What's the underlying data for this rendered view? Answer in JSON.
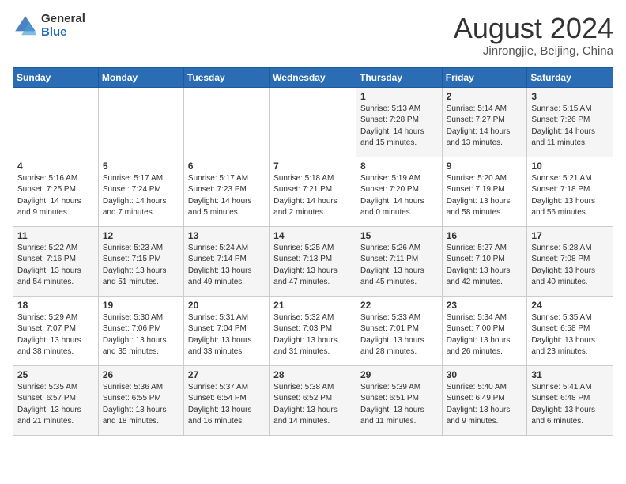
{
  "header": {
    "logo_general": "General",
    "logo_blue": "Blue",
    "title": "August 2024",
    "subtitle": "Jinrongjie, Beijing, China"
  },
  "weekdays": [
    "Sunday",
    "Monday",
    "Tuesday",
    "Wednesday",
    "Thursday",
    "Friday",
    "Saturday"
  ],
  "weeks": [
    [
      {
        "day": "",
        "sunrise": "",
        "sunset": "",
        "daylight": ""
      },
      {
        "day": "",
        "sunrise": "",
        "sunset": "",
        "daylight": ""
      },
      {
        "day": "",
        "sunrise": "",
        "sunset": "",
        "daylight": ""
      },
      {
        "day": "",
        "sunrise": "",
        "sunset": "",
        "daylight": ""
      },
      {
        "day": "1",
        "sunrise": "Sunrise: 5:13 AM",
        "sunset": "Sunset: 7:28 PM",
        "daylight": "Daylight: 14 hours and 15 minutes."
      },
      {
        "day": "2",
        "sunrise": "Sunrise: 5:14 AM",
        "sunset": "Sunset: 7:27 PM",
        "daylight": "Daylight: 14 hours and 13 minutes."
      },
      {
        "day": "3",
        "sunrise": "Sunrise: 5:15 AM",
        "sunset": "Sunset: 7:26 PM",
        "daylight": "Daylight: 14 hours and 11 minutes."
      }
    ],
    [
      {
        "day": "4",
        "sunrise": "Sunrise: 5:16 AM",
        "sunset": "Sunset: 7:25 PM",
        "daylight": "Daylight: 14 hours and 9 minutes."
      },
      {
        "day": "5",
        "sunrise": "Sunrise: 5:17 AM",
        "sunset": "Sunset: 7:24 PM",
        "daylight": "Daylight: 14 hours and 7 minutes."
      },
      {
        "day": "6",
        "sunrise": "Sunrise: 5:17 AM",
        "sunset": "Sunset: 7:23 PM",
        "daylight": "Daylight: 14 hours and 5 minutes."
      },
      {
        "day": "7",
        "sunrise": "Sunrise: 5:18 AM",
        "sunset": "Sunset: 7:21 PM",
        "daylight": "Daylight: 14 hours and 2 minutes."
      },
      {
        "day": "8",
        "sunrise": "Sunrise: 5:19 AM",
        "sunset": "Sunset: 7:20 PM",
        "daylight": "Daylight: 14 hours and 0 minutes."
      },
      {
        "day": "9",
        "sunrise": "Sunrise: 5:20 AM",
        "sunset": "Sunset: 7:19 PM",
        "daylight": "Daylight: 13 hours and 58 minutes."
      },
      {
        "day": "10",
        "sunrise": "Sunrise: 5:21 AM",
        "sunset": "Sunset: 7:18 PM",
        "daylight": "Daylight: 13 hours and 56 minutes."
      }
    ],
    [
      {
        "day": "11",
        "sunrise": "Sunrise: 5:22 AM",
        "sunset": "Sunset: 7:16 PM",
        "daylight": "Daylight: 13 hours and 54 minutes."
      },
      {
        "day": "12",
        "sunrise": "Sunrise: 5:23 AM",
        "sunset": "Sunset: 7:15 PM",
        "daylight": "Daylight: 13 hours and 51 minutes."
      },
      {
        "day": "13",
        "sunrise": "Sunrise: 5:24 AM",
        "sunset": "Sunset: 7:14 PM",
        "daylight": "Daylight: 13 hours and 49 minutes."
      },
      {
        "day": "14",
        "sunrise": "Sunrise: 5:25 AM",
        "sunset": "Sunset: 7:13 PM",
        "daylight": "Daylight: 13 hours and 47 minutes."
      },
      {
        "day": "15",
        "sunrise": "Sunrise: 5:26 AM",
        "sunset": "Sunset: 7:11 PM",
        "daylight": "Daylight: 13 hours and 45 minutes."
      },
      {
        "day": "16",
        "sunrise": "Sunrise: 5:27 AM",
        "sunset": "Sunset: 7:10 PM",
        "daylight": "Daylight: 13 hours and 42 minutes."
      },
      {
        "day": "17",
        "sunrise": "Sunrise: 5:28 AM",
        "sunset": "Sunset: 7:08 PM",
        "daylight": "Daylight: 13 hours and 40 minutes."
      }
    ],
    [
      {
        "day": "18",
        "sunrise": "Sunrise: 5:29 AM",
        "sunset": "Sunset: 7:07 PM",
        "daylight": "Daylight: 13 hours and 38 minutes."
      },
      {
        "day": "19",
        "sunrise": "Sunrise: 5:30 AM",
        "sunset": "Sunset: 7:06 PM",
        "daylight": "Daylight: 13 hours and 35 minutes."
      },
      {
        "day": "20",
        "sunrise": "Sunrise: 5:31 AM",
        "sunset": "Sunset: 7:04 PM",
        "daylight": "Daylight: 13 hours and 33 minutes."
      },
      {
        "day": "21",
        "sunrise": "Sunrise: 5:32 AM",
        "sunset": "Sunset: 7:03 PM",
        "daylight": "Daylight: 13 hours and 31 minutes."
      },
      {
        "day": "22",
        "sunrise": "Sunrise: 5:33 AM",
        "sunset": "Sunset: 7:01 PM",
        "daylight": "Daylight: 13 hours and 28 minutes."
      },
      {
        "day": "23",
        "sunrise": "Sunrise: 5:34 AM",
        "sunset": "Sunset: 7:00 PM",
        "daylight": "Daylight: 13 hours and 26 minutes."
      },
      {
        "day": "24",
        "sunrise": "Sunrise: 5:35 AM",
        "sunset": "Sunset: 6:58 PM",
        "daylight": "Daylight: 13 hours and 23 minutes."
      }
    ],
    [
      {
        "day": "25",
        "sunrise": "Sunrise: 5:35 AM",
        "sunset": "Sunset: 6:57 PM",
        "daylight": "Daylight: 13 hours and 21 minutes."
      },
      {
        "day": "26",
        "sunrise": "Sunrise: 5:36 AM",
        "sunset": "Sunset: 6:55 PM",
        "daylight": "Daylight: 13 hours and 18 minutes."
      },
      {
        "day": "27",
        "sunrise": "Sunrise: 5:37 AM",
        "sunset": "Sunset: 6:54 PM",
        "daylight": "Daylight: 13 hours and 16 minutes."
      },
      {
        "day": "28",
        "sunrise": "Sunrise: 5:38 AM",
        "sunset": "Sunset: 6:52 PM",
        "daylight": "Daylight: 13 hours and 14 minutes."
      },
      {
        "day": "29",
        "sunrise": "Sunrise: 5:39 AM",
        "sunset": "Sunset: 6:51 PM",
        "daylight": "Daylight: 13 hours and 11 minutes."
      },
      {
        "day": "30",
        "sunrise": "Sunrise: 5:40 AM",
        "sunset": "Sunset: 6:49 PM",
        "daylight": "Daylight: 13 hours and 9 minutes."
      },
      {
        "day": "31",
        "sunrise": "Sunrise: 5:41 AM",
        "sunset": "Sunset: 6:48 PM",
        "daylight": "Daylight: 13 hours and 6 minutes."
      }
    ]
  ]
}
